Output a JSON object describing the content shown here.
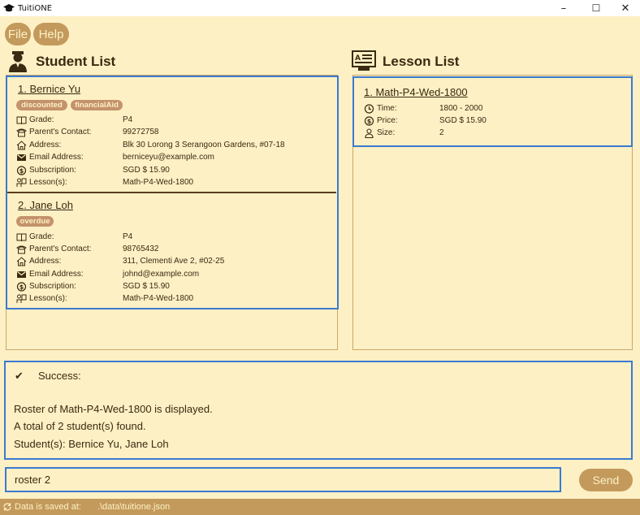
{
  "window": {
    "title": "TuitiONE",
    "minimize": "–",
    "maximize": "☐",
    "close": "✕"
  },
  "menu": {
    "file": "File",
    "help": "Help"
  },
  "student_list": {
    "title": "Student List",
    "students": [
      {
        "name": "1.  Bernice Yu",
        "tags": [
          "discounted",
          "financialAid"
        ],
        "fields": [
          {
            "icon": "book-icon",
            "label": "Grade:",
            "value": "P4"
          },
          {
            "icon": "phone-icon",
            "label": "Parent's Contact:",
            "value": "99272758"
          },
          {
            "icon": "home-icon",
            "label": "Address:",
            "value": "Blk 30 Lorong 3 Serangoon Gardens, #07-18"
          },
          {
            "icon": "email-icon",
            "label": "Email Address:",
            "value": "berniceyu@example.com"
          },
          {
            "icon": "dollar-icon",
            "label": "Subscription:",
            "value": "SGD $ 15.90"
          },
          {
            "icon": "lesson-icon",
            "label": "Lesson(s):",
            "value": "Math-P4-Wed-1800"
          }
        ]
      },
      {
        "name": "2.  Jane Loh",
        "tags": [
          "overdue"
        ],
        "fields": [
          {
            "icon": "book-icon",
            "label": "Grade:",
            "value": "P4"
          },
          {
            "icon": "phone-icon",
            "label": "Parent's Contact:",
            "value": "98765432"
          },
          {
            "icon": "home-icon",
            "label": "Address:",
            "value": "311, Clementi Ave 2, #02-25"
          },
          {
            "icon": "email-icon",
            "label": "Email Address:",
            "value": "johnd@example.com"
          },
          {
            "icon": "dollar-icon",
            "label": "Subscription:",
            "value": "SGD $ 15.90"
          },
          {
            "icon": "lesson-icon",
            "label": "Lesson(s):",
            "value": "Math-P4-Wed-1800"
          }
        ]
      }
    ]
  },
  "lesson_list": {
    "title": "Lesson List",
    "lessons": [
      {
        "name": "1.  Math-P4-Wed-1800",
        "fields": [
          {
            "icon": "clock-icon",
            "label": "Time:",
            "value": "1800 - 2000"
          },
          {
            "icon": "dollar-icon",
            "label": "Price:",
            "value": "SGD $ 15.90"
          },
          {
            "icon": "person-icon",
            "label": "Size:",
            "value": "2"
          }
        ]
      }
    ]
  },
  "result": {
    "check": "✔",
    "status": "Success:",
    "lines": [
      "Roster of Math-P4-Wed-1800 is displayed.",
      "A total of 2 student(s) found.",
      "Student(s): Bernice Yu, Jane Loh"
    ]
  },
  "command": {
    "value": "roster 2",
    "send_label": "Send"
  },
  "status_bar": {
    "label": "Data is saved at:",
    "path": ".\\data\\tuitione.json"
  },
  "colors": {
    "background": "#fdf0c4",
    "accent": "#c39a5c",
    "tag": "#c4926b",
    "highlight": "#3b79d0",
    "text": "#3a2a12"
  }
}
